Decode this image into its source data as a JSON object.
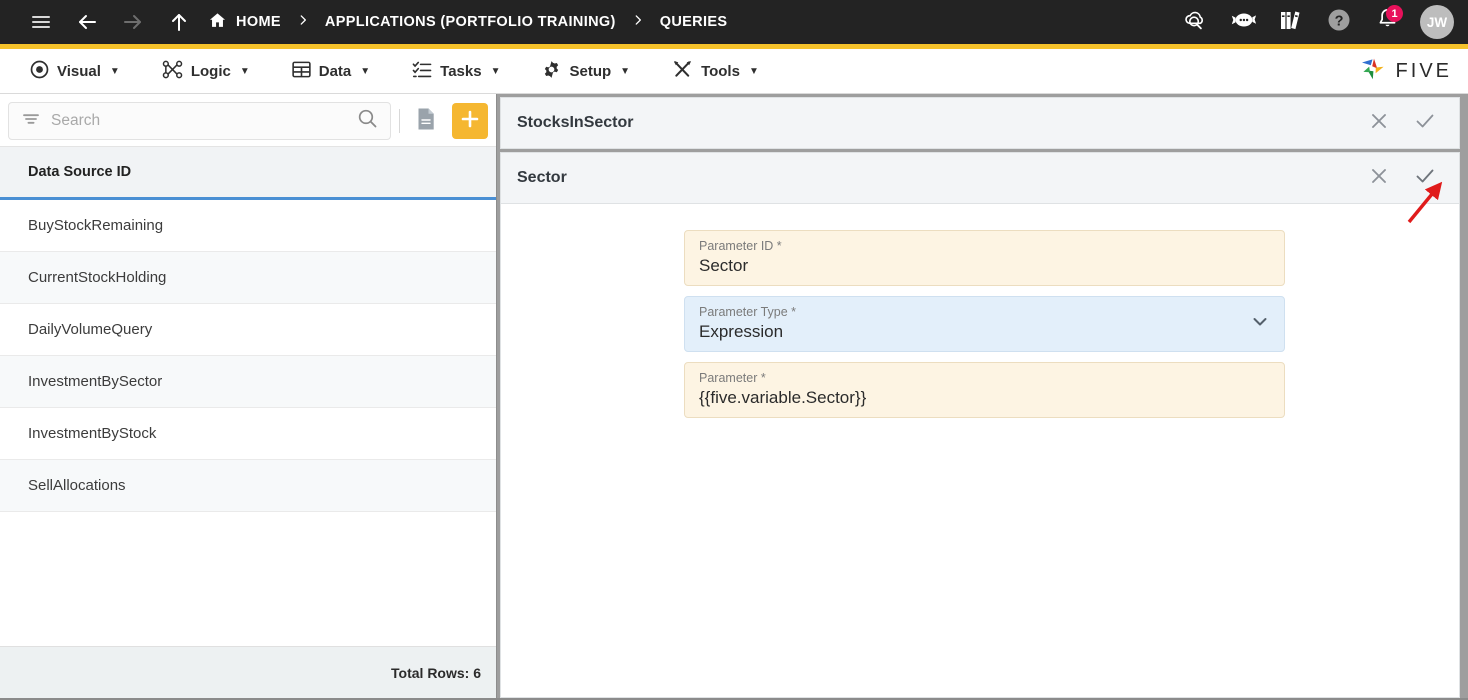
{
  "header": {
    "nav": {
      "menu_icon": "hamburger-icon",
      "back_icon": "arrow-left-icon",
      "forward_icon": "arrow-right-icon",
      "up_icon": "arrow-up-icon"
    },
    "breadcrumbs": [
      {
        "label": "HOME",
        "icon": "home-icon"
      },
      {
        "label": "APPLICATIONS (PORTFOLIO TRAINING)",
        "icon": ""
      },
      {
        "label": "QUERIES",
        "icon": ""
      }
    ],
    "separator": "›",
    "actions": [
      {
        "name": "cloud-search-icon",
        "label": ""
      },
      {
        "name": "chatbot-icon",
        "label": ""
      },
      {
        "name": "library-books-icon",
        "label": ""
      },
      {
        "name": "help-circle-icon",
        "label": ""
      },
      {
        "name": "notification-bell-icon",
        "label": "",
        "badge": "1"
      }
    ],
    "avatar_initials": "JW",
    "accent_color": "#F5C22B",
    "background_color": "#232323"
  },
  "menubar": {
    "items": [
      {
        "label": "Visual",
        "icon": "eye-icon",
        "caret": "▼"
      },
      {
        "label": "Logic",
        "icon": "logic-nodes-icon",
        "caret": "▼"
      },
      {
        "label": "Data",
        "icon": "table-grid-icon",
        "caret": "▼"
      },
      {
        "label": "Tasks",
        "icon": "checklist-icon",
        "caret": "▼"
      },
      {
        "label": "Setup",
        "icon": "gear-icon",
        "caret": "▼"
      },
      {
        "label": "Tools",
        "icon": "tools-cross-icon",
        "caret": "▼"
      }
    ],
    "brand": {
      "name": "five-logo",
      "text": "FIVE"
    }
  },
  "sidebar": {
    "search": {
      "placeholder": "Search",
      "value": "",
      "filter_icon": "filter-icon",
      "search_icon": "search-icon"
    },
    "doc_button": {
      "name": "document-icon",
      "label": ""
    },
    "add_button": {
      "name": "plus-icon",
      "label": "+"
    },
    "column_header": "Data Source ID",
    "rows": [
      {
        "label": "BuyStockRemaining"
      },
      {
        "label": "CurrentStockHolding"
      },
      {
        "label": "DailyVolumeQuery"
      },
      {
        "label": "InvestmentBySector"
      },
      {
        "label": "InvestmentByStock"
      },
      {
        "label": "SellAllocations"
      }
    ],
    "footer": "Total Rows: 6",
    "header_underline_color": "#4A8FD4"
  },
  "detail": {
    "outer_card": {
      "title": "StocksInSector",
      "close_icon": "close-x-icon",
      "confirm_icon": "checkmark-icon"
    },
    "inner_card": {
      "title": "Sector",
      "close_icon": "close-x-icon",
      "confirm_icon": "checkmark-icon"
    },
    "fields": [
      {
        "label": "Parameter ID *",
        "value": "Sector",
        "style": "cream",
        "control": "text"
      },
      {
        "label": "Parameter Type *",
        "value": "Expression",
        "style": "blue",
        "control": "select",
        "chevron": "chevron-down-icon"
      },
      {
        "label": "Parameter *",
        "value": "{{five.variable.Sector}}",
        "style": "cream",
        "control": "text"
      }
    ],
    "annotation": {
      "name": "red-arrow-annotation",
      "color": "#E01B1B",
      "points_to": "inner-card-confirm-button"
    }
  }
}
